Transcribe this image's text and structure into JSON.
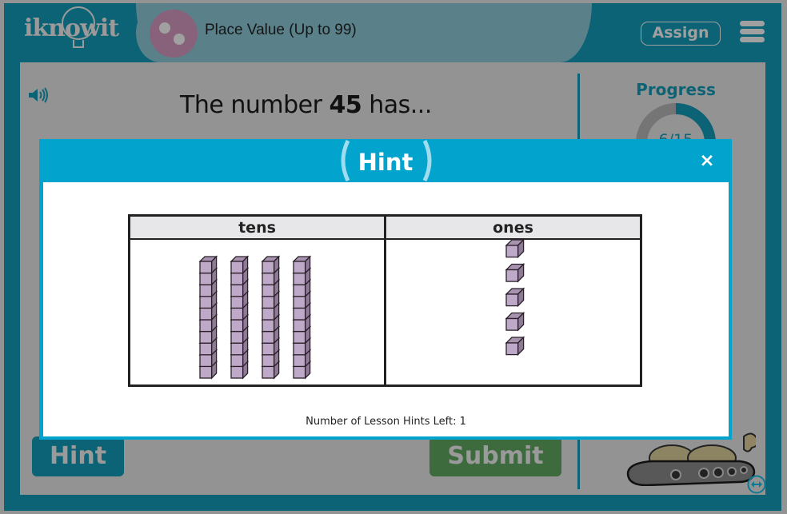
{
  "header": {
    "logo_text": "iknowit",
    "lesson_title": "Place Value (Up to 99)",
    "assign_label": "Assign"
  },
  "question": {
    "prefix": "The number ",
    "number": "45",
    "suffix": " has..."
  },
  "progress": {
    "title": "Progress",
    "current": 6,
    "total": 15,
    "label": "6/15"
  },
  "buttons": {
    "hint_label": "Hint",
    "submit_label": "Submit"
  },
  "modal": {
    "title": "Hint",
    "close_symbol": "×",
    "table": {
      "columns": [
        "tens",
        "ones"
      ],
      "tens_rods": 4,
      "ones_cubes": 5
    },
    "hints_left_text": "Number of Lesson Hints Left: 1"
  },
  "colors": {
    "brand_teal": "#0b6375",
    "modal_blue": "#02a3cd",
    "submit_green": "#3d6b3e",
    "block_face": "#bfa9c9",
    "block_side": "#8f7b98"
  },
  "icons": {
    "speaker": "speaker-icon",
    "menu": "hamburger-menu-icon",
    "close": "close-icon",
    "expand": "expand-horizontal-icon"
  }
}
